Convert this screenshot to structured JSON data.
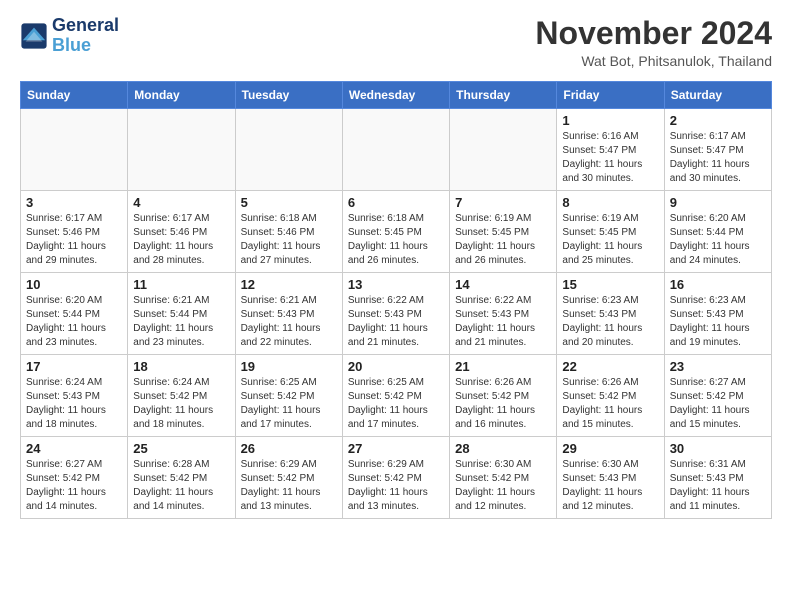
{
  "header": {
    "logo_line1": "General",
    "logo_line2": "Blue",
    "month_title": "November 2024",
    "location": "Wat Bot, Phitsanulok, Thailand"
  },
  "weekdays": [
    "Sunday",
    "Monday",
    "Tuesday",
    "Wednesday",
    "Thursday",
    "Friday",
    "Saturday"
  ],
  "weeks": [
    [
      {
        "day": "",
        "info": ""
      },
      {
        "day": "",
        "info": ""
      },
      {
        "day": "",
        "info": ""
      },
      {
        "day": "",
        "info": ""
      },
      {
        "day": "",
        "info": ""
      },
      {
        "day": "1",
        "info": "Sunrise: 6:16 AM\nSunset: 5:47 PM\nDaylight: 11 hours and 30 minutes."
      },
      {
        "day": "2",
        "info": "Sunrise: 6:17 AM\nSunset: 5:47 PM\nDaylight: 11 hours and 30 minutes."
      }
    ],
    [
      {
        "day": "3",
        "info": "Sunrise: 6:17 AM\nSunset: 5:46 PM\nDaylight: 11 hours and 29 minutes."
      },
      {
        "day": "4",
        "info": "Sunrise: 6:17 AM\nSunset: 5:46 PM\nDaylight: 11 hours and 28 minutes."
      },
      {
        "day": "5",
        "info": "Sunrise: 6:18 AM\nSunset: 5:46 PM\nDaylight: 11 hours and 27 minutes."
      },
      {
        "day": "6",
        "info": "Sunrise: 6:18 AM\nSunset: 5:45 PM\nDaylight: 11 hours and 26 minutes."
      },
      {
        "day": "7",
        "info": "Sunrise: 6:19 AM\nSunset: 5:45 PM\nDaylight: 11 hours and 26 minutes."
      },
      {
        "day": "8",
        "info": "Sunrise: 6:19 AM\nSunset: 5:45 PM\nDaylight: 11 hours and 25 minutes."
      },
      {
        "day": "9",
        "info": "Sunrise: 6:20 AM\nSunset: 5:44 PM\nDaylight: 11 hours and 24 minutes."
      }
    ],
    [
      {
        "day": "10",
        "info": "Sunrise: 6:20 AM\nSunset: 5:44 PM\nDaylight: 11 hours and 23 minutes."
      },
      {
        "day": "11",
        "info": "Sunrise: 6:21 AM\nSunset: 5:44 PM\nDaylight: 11 hours and 23 minutes."
      },
      {
        "day": "12",
        "info": "Sunrise: 6:21 AM\nSunset: 5:43 PM\nDaylight: 11 hours and 22 minutes."
      },
      {
        "day": "13",
        "info": "Sunrise: 6:22 AM\nSunset: 5:43 PM\nDaylight: 11 hours and 21 minutes."
      },
      {
        "day": "14",
        "info": "Sunrise: 6:22 AM\nSunset: 5:43 PM\nDaylight: 11 hours and 21 minutes."
      },
      {
        "day": "15",
        "info": "Sunrise: 6:23 AM\nSunset: 5:43 PM\nDaylight: 11 hours and 20 minutes."
      },
      {
        "day": "16",
        "info": "Sunrise: 6:23 AM\nSunset: 5:43 PM\nDaylight: 11 hours and 19 minutes."
      }
    ],
    [
      {
        "day": "17",
        "info": "Sunrise: 6:24 AM\nSunset: 5:43 PM\nDaylight: 11 hours and 18 minutes."
      },
      {
        "day": "18",
        "info": "Sunrise: 6:24 AM\nSunset: 5:42 PM\nDaylight: 11 hours and 18 minutes."
      },
      {
        "day": "19",
        "info": "Sunrise: 6:25 AM\nSunset: 5:42 PM\nDaylight: 11 hours and 17 minutes."
      },
      {
        "day": "20",
        "info": "Sunrise: 6:25 AM\nSunset: 5:42 PM\nDaylight: 11 hours and 17 minutes."
      },
      {
        "day": "21",
        "info": "Sunrise: 6:26 AM\nSunset: 5:42 PM\nDaylight: 11 hours and 16 minutes."
      },
      {
        "day": "22",
        "info": "Sunrise: 6:26 AM\nSunset: 5:42 PM\nDaylight: 11 hours and 15 minutes."
      },
      {
        "day": "23",
        "info": "Sunrise: 6:27 AM\nSunset: 5:42 PM\nDaylight: 11 hours and 15 minutes."
      }
    ],
    [
      {
        "day": "24",
        "info": "Sunrise: 6:27 AM\nSunset: 5:42 PM\nDaylight: 11 hours and 14 minutes."
      },
      {
        "day": "25",
        "info": "Sunrise: 6:28 AM\nSunset: 5:42 PM\nDaylight: 11 hours and 14 minutes."
      },
      {
        "day": "26",
        "info": "Sunrise: 6:29 AM\nSunset: 5:42 PM\nDaylight: 11 hours and 13 minutes."
      },
      {
        "day": "27",
        "info": "Sunrise: 6:29 AM\nSunset: 5:42 PM\nDaylight: 11 hours and 13 minutes."
      },
      {
        "day": "28",
        "info": "Sunrise: 6:30 AM\nSunset: 5:42 PM\nDaylight: 11 hours and 12 minutes."
      },
      {
        "day": "29",
        "info": "Sunrise: 6:30 AM\nSunset: 5:43 PM\nDaylight: 11 hours and 12 minutes."
      },
      {
        "day": "30",
        "info": "Sunrise: 6:31 AM\nSunset: 5:43 PM\nDaylight: 11 hours and 11 minutes."
      }
    ]
  ]
}
